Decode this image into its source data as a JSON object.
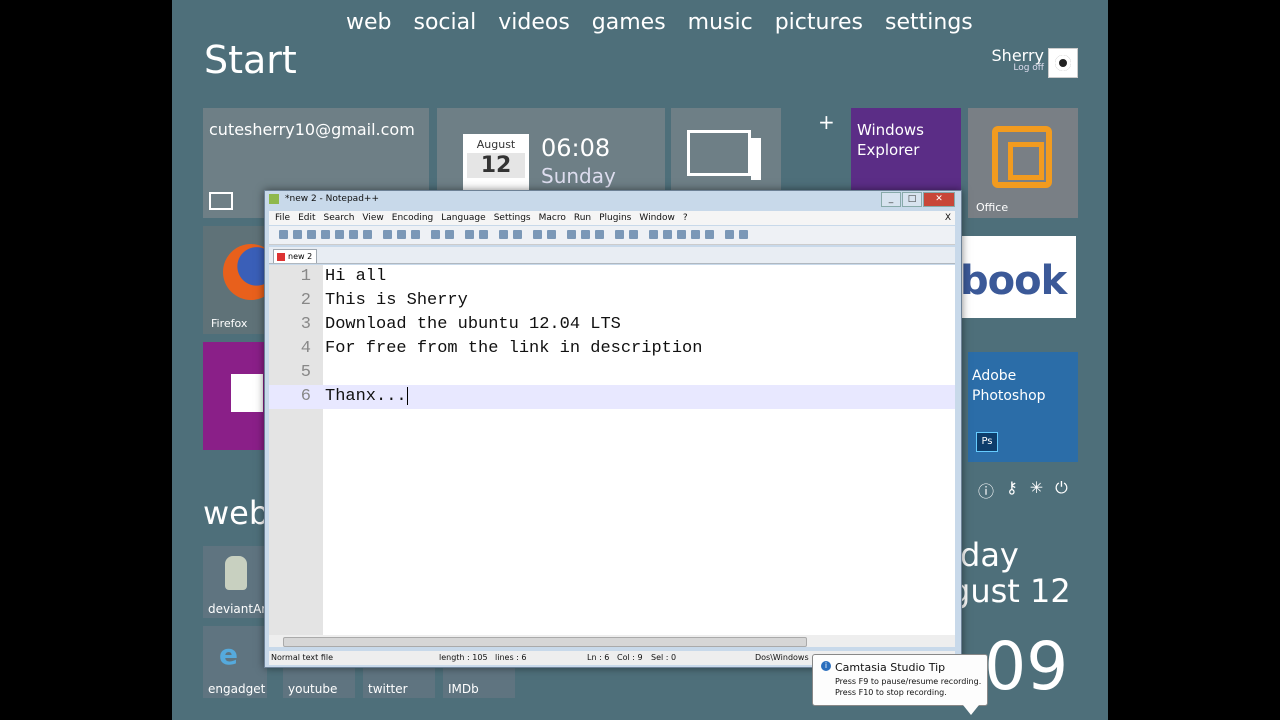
{
  "nav": [
    "web",
    "social",
    "videos",
    "games",
    "music",
    "pictures",
    "settings"
  ],
  "start_title": "Start",
  "user": {
    "name": "Sherry",
    "logoff": "Log off"
  },
  "tiles": {
    "mail": "cutesherry10@gmail.com",
    "calendar_month": "August",
    "calendar_day": "12",
    "clock_time": "06:08",
    "clock_day": "Sunday",
    "plus": "+",
    "explorer": "Windows Explorer",
    "office": "Office",
    "facebook": "book",
    "photoshop": "Adobe Photoshop",
    "photoshop_badge": "Ps",
    "firefox": "Firefox"
  },
  "web_section": {
    "header": "web",
    "tiles": [
      "deviantArt",
      "engadget",
      "youtube",
      "twitter",
      "IMDb"
    ]
  },
  "right_clock": {
    "day": "day",
    "date": "gust 12",
    "time": ":09"
  },
  "notepad": {
    "title": "*new  2 - Notepad++",
    "menu": [
      "File",
      "Edit",
      "Search",
      "View",
      "Encoding",
      "Language",
      "Settings",
      "Macro",
      "Run",
      "Plugins",
      "Window",
      "?"
    ],
    "menu_close": "X",
    "tab": "new  2",
    "lines": [
      {
        "num": "1",
        "text": "Hi all"
      },
      {
        "num": "2",
        "text": "This is Sherry"
      },
      {
        "num": "3",
        "text": "Download the ubuntu 12.04 LTS"
      },
      {
        "num": "4",
        "text": "For free from the link in description"
      },
      {
        "num": "5",
        "text": ""
      },
      {
        "num": "6",
        "text": "Thanx..."
      }
    ],
    "status": {
      "type": "Normal text file",
      "length": "length : 105",
      "lines": "lines : 6",
      "ln": "Ln : 6",
      "col": "Col : 9",
      "sel": "Sel : 0",
      "eol": "Dos\\Windows"
    }
  },
  "camtasia_tip": {
    "title": "Camtasia Studio Tip",
    "line1": "Press F9 to pause/resume recording.",
    "line2": "Press F10 to stop recording."
  }
}
